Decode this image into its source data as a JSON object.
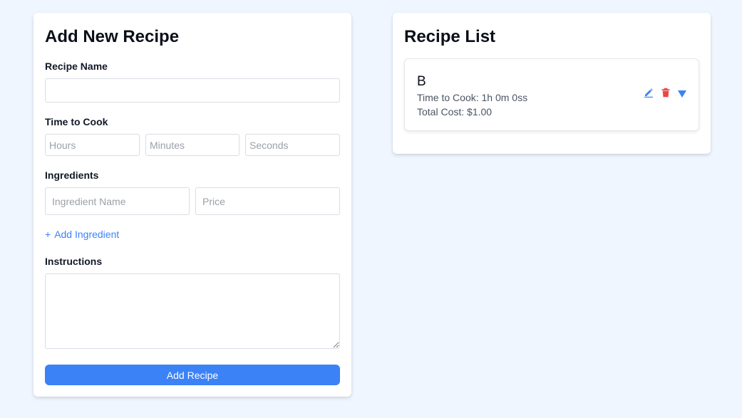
{
  "form": {
    "title": "Add New Recipe",
    "recipe_name_label": "Recipe Name",
    "recipe_name_value": "",
    "time_label": "Time to Cook",
    "hours_placeholder": "Hours",
    "minutes_placeholder": "Minutes",
    "seconds_placeholder": "Seconds",
    "ingredients_label": "Ingredients",
    "ingredient_name_placeholder": "Ingredient Name",
    "price_placeholder": "Price",
    "add_ingredient_plus": "+",
    "add_ingredient_label": "Add Ingredient",
    "instructions_label": "Instructions",
    "instructions_value": "",
    "submit_label": "Add Recipe"
  },
  "list": {
    "title": "Recipe List",
    "recipes": [
      {
        "name": "B",
        "time": "Time to Cook: 1h 0m 0ss",
        "cost": "Total Cost: $1.00"
      }
    ]
  },
  "colors": {
    "background": "#f0f6ff",
    "accent": "#3b82f6",
    "delete": "#ef4444"
  },
  "icons": {
    "edit": "pencil-icon",
    "delete": "trash-icon",
    "expand": "triangle-down-icon"
  }
}
